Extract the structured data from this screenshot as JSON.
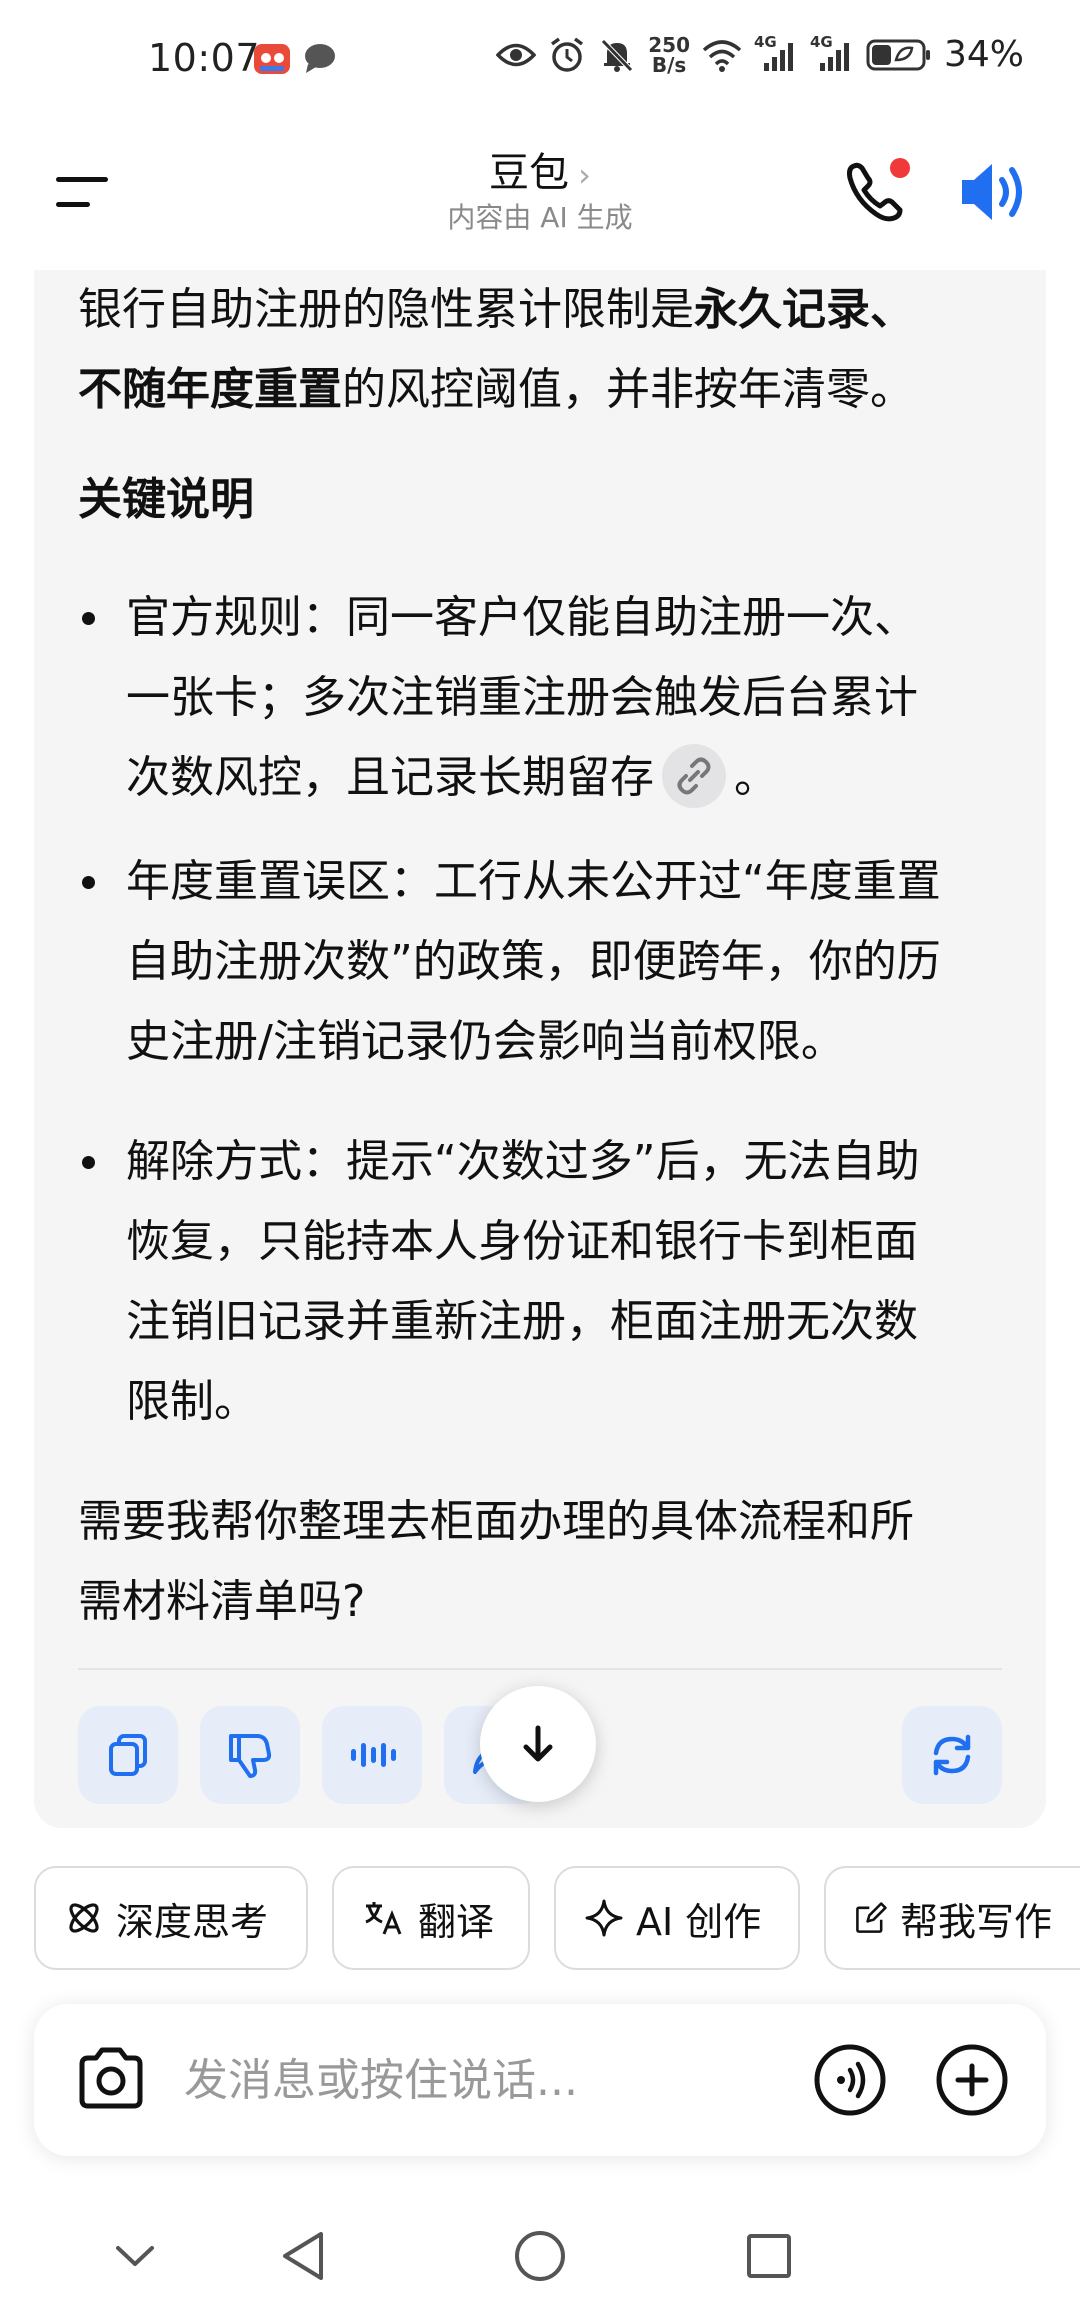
{
  "status_bar": {
    "time": "10:07",
    "net_speed_value": "250",
    "net_speed_unit": "B/s",
    "signal_1_label": "4G",
    "signal_2_label": "4G",
    "battery_percent": "34%"
  },
  "header": {
    "title": "豆包",
    "title_chevron": "›",
    "subtitle": "内容由 AI 生成",
    "icons": [
      "menu-icon",
      "phone-call-icon",
      "speaker-icon"
    ],
    "accent_color": "#1f6ff0",
    "notification_dot_color": "#f03a3a"
  },
  "message": {
    "intro_part1": "银行自助注册的隐性累计限制是",
    "intro_bold1": "永久记录、",
    "intro_bold2": "不随年度重置",
    "intro_part2": "的风控阈值，并非按年清零。",
    "section_title": "关键说明",
    "bullets": [
      {
        "line1": "官方规则：同一客户仅能自助注册一次、",
        "line2": "一张卡；多次注销重注册会触发后台累计",
        "line3_before_link": "次数风控，且记录长期留存",
        "line3_after_link": "。"
      },
      {
        "line1": "年度重置误区：工行从未公开过“年度重置",
        "line2": "自助注册次数”的政策，即便跨年，你的历",
        "line3": "史注册/注销记录仍会影响当前权限。"
      },
      {
        "line1": "解除方式：提示“次数过多”后，无法自助",
        "line2": "恢复，只能持本人身份证和银行卡到柜面",
        "line3": "注销旧记录并重新注册，柜面注册无次数",
        "line4": "限制。"
      }
    ],
    "closing_line1": "需要我帮你整理去柜面办理的具体流程和所",
    "closing_line2": "需材料清单吗?",
    "actions": [
      "copy-icon",
      "thumbs-down-icon",
      "voice-play-icon",
      "share-icon",
      "regenerate-icon"
    ],
    "scroll_down_icon": "arrow-down-icon"
  },
  "chips": [
    {
      "icon": "deep-think-icon",
      "label": "深度思考"
    },
    {
      "icon": "translate-icon",
      "label": "翻译"
    },
    {
      "icon": "sparkle-icon",
      "label": "AI 创作"
    },
    {
      "icon": "edit-icon",
      "label": "帮我写作"
    }
  ],
  "input": {
    "placeholder": "发消息或按住说话...",
    "value": "",
    "icons": [
      "camera-icon",
      "voice-input-icon",
      "plus-icon"
    ]
  },
  "nav_bar": {
    "icons": [
      "nav-down-icon",
      "nav-back-icon",
      "nav-home-icon",
      "nav-recents-icon"
    ]
  }
}
